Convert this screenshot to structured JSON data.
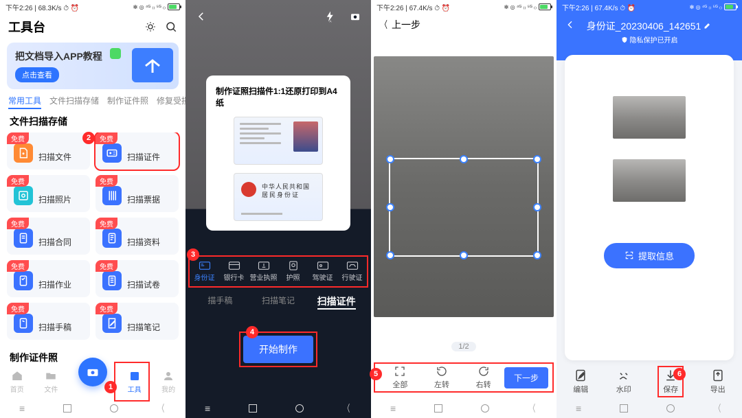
{
  "status": {
    "s1": {
      "left": "下午2:26 | 68.3K/s ⏱ ⏰",
      "right": "81"
    },
    "s3": {
      "left": "下午2:26 | 67.4K/s ⏱ ⏰",
      "right": "81"
    },
    "s4": {
      "left": "下午2:26 | 67.4K/s ⏱ ⏰",
      "right": "81"
    }
  },
  "s1": {
    "title": "工具台",
    "banner_title": "把文档导入APP教程",
    "banner_btn": "点击查看",
    "tabs": [
      "常用工具",
      "文件扫描存储",
      "制作证件照",
      "修复受损照片"
    ],
    "section1": "文件扫描存储",
    "section2": "制作证件照",
    "free": "免费",
    "items": [
      {
        "label": "扫描文件",
        "color": "#ff8a34"
      },
      {
        "label": "扫描证件",
        "color": "#3b72ff",
        "marked": true
      },
      {
        "label": "扫描照片",
        "color": "#22c3d6"
      },
      {
        "label": "扫描票据",
        "color": "#3b72ff"
      },
      {
        "label": "扫描合同",
        "color": "#3b72ff"
      },
      {
        "label": "扫描资料",
        "color": "#3b72ff"
      },
      {
        "label": "扫描作业",
        "color": "#3b72ff"
      },
      {
        "label": "扫描试卷",
        "color": "#3b72ff"
      },
      {
        "label": "扫描手稿",
        "color": "#3b72ff"
      },
      {
        "label": "扫描笔记",
        "color": "#3b72ff"
      }
    ],
    "bottom": [
      "首页",
      "文件",
      "工具",
      "我的"
    ]
  },
  "s2": {
    "card_title": "制作证照扫描件1:1还原打印到A4纸",
    "id_back_l1": "中华人民共和国",
    "id_back_l2": "居民身份证",
    "doctabs": [
      "身份证",
      "银行卡",
      "营业执照",
      "护照",
      "驾驶证",
      "行驶证"
    ],
    "bigtabs": [
      "描手稿",
      "扫描笔记",
      "扫描证件"
    ],
    "cta": "开始制作"
  },
  "s3": {
    "back": "上一步",
    "pager": "1/2",
    "actions": [
      "全部",
      "左转",
      "右转"
    ],
    "next": "下一步"
  },
  "s4": {
    "title": "身份证_20230406_142651",
    "sub": "隐私保护已开启",
    "extract": "提取信息",
    "bottom": [
      "编辑",
      "水印",
      "保存",
      "导出"
    ]
  },
  "markers": {
    "m1": "1",
    "m2": "2",
    "m3": "3",
    "m4": "4",
    "m5": "5",
    "m6": "6"
  }
}
